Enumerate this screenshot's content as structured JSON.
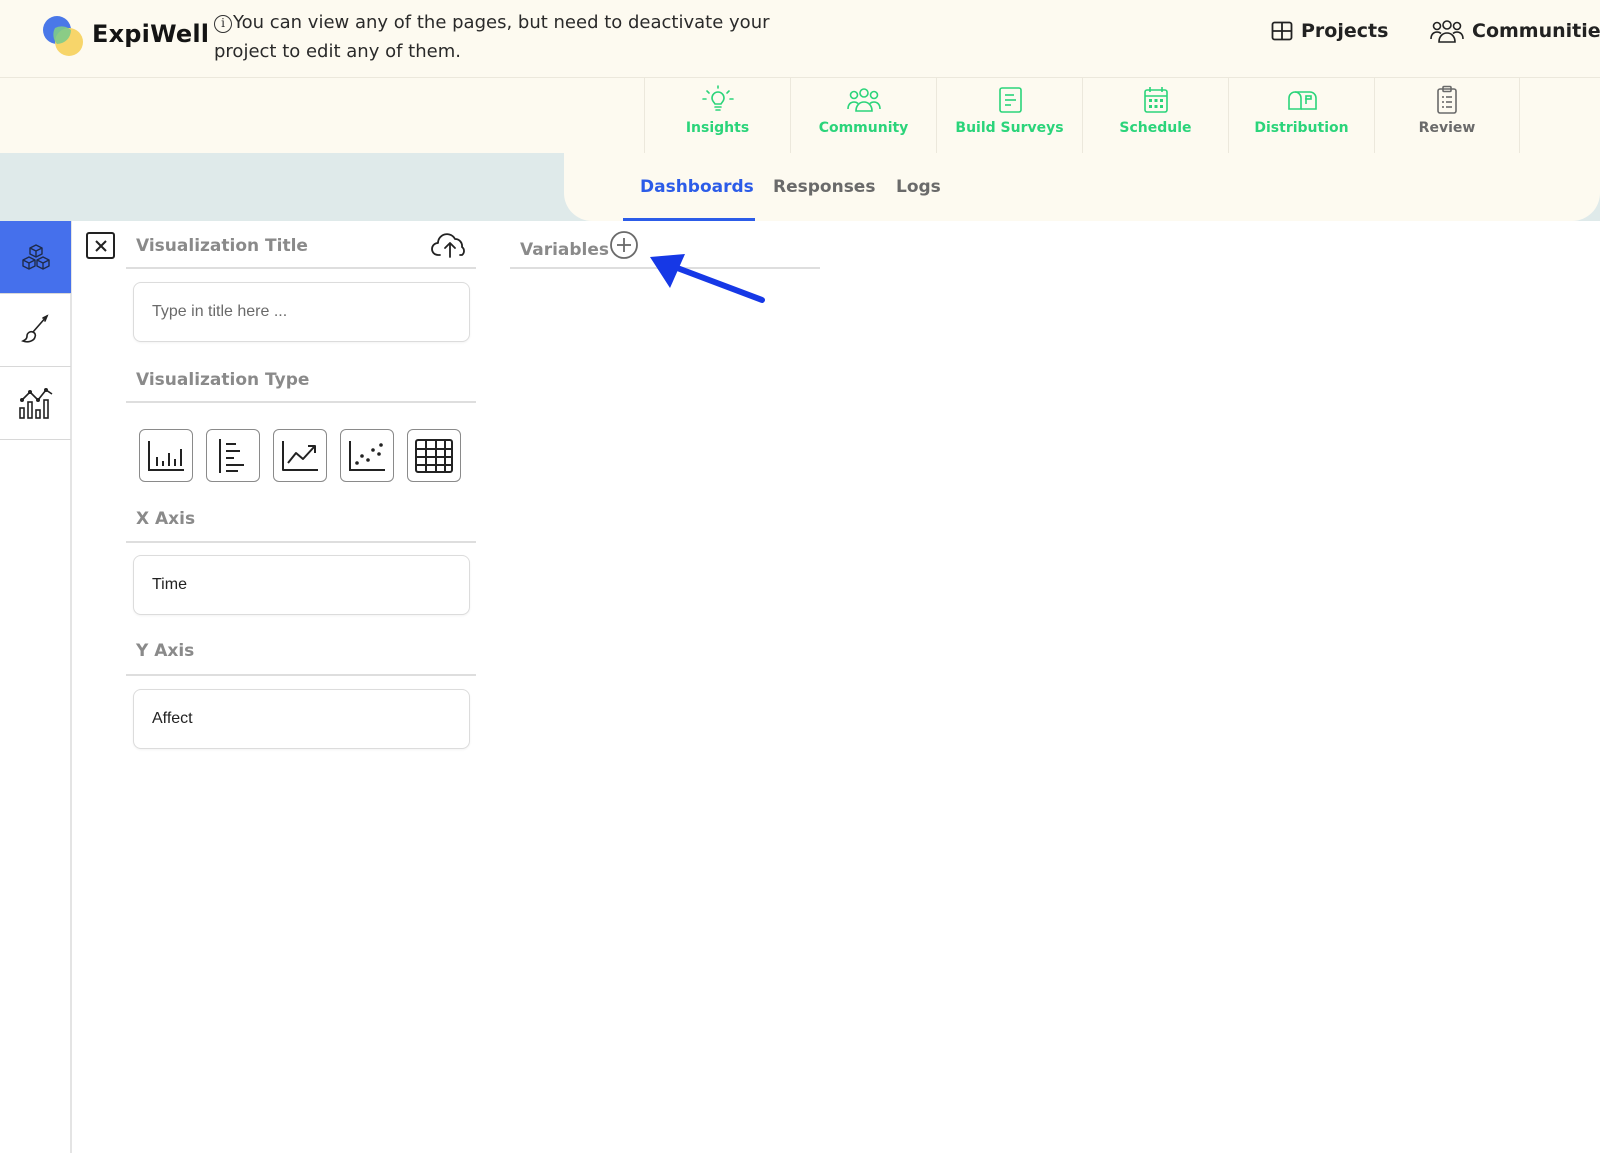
{
  "header": {
    "brand": "ExpiWell",
    "notice_icon": "i",
    "notice": "You can view any of the pages, but need to deactivate your project to edit any of them.",
    "links": [
      {
        "label": "Projects",
        "icon": "grid-icon"
      },
      {
        "label": "Communities",
        "icon": "people-icon"
      }
    ]
  },
  "modules": [
    {
      "label": "Insights",
      "icon": "lightbulb-icon"
    },
    {
      "label": "Community",
      "icon": "people-icon"
    },
    {
      "label": "Build Surveys",
      "icon": "survey-icon"
    },
    {
      "label": "Schedule",
      "icon": "calendar-icon"
    },
    {
      "label": "Distribution",
      "icon": "mailbox-icon"
    },
    {
      "label": "Review",
      "icon": "clipboard-icon"
    }
  ],
  "tabs": [
    {
      "label": "Dashboards",
      "active": true
    },
    {
      "label": "Responses",
      "active": false
    },
    {
      "label": "Logs",
      "active": false
    }
  ],
  "rail": [
    "cubes-icon",
    "brush-icon",
    "chart-icon"
  ],
  "editor": {
    "title_label": "Visualization Title",
    "title_placeholder": "Type in title here ...",
    "type_label": "Visualization Type",
    "types": [
      "bar-chart-icon",
      "horizontal-bar-icon",
      "line-chart-icon",
      "scatter-icon",
      "table-icon"
    ],
    "x_label": "X Axis",
    "x_value": "Time",
    "y_label": "Y Axis",
    "y_value": "Affect"
  },
  "variables": {
    "label": "Variables"
  },
  "colors": {
    "accent": "#2c5ce8",
    "green": "#2bd47a",
    "rail_active": "#4570ec",
    "header_bg": "#fdfaf0",
    "band_bg": "#dfeaea",
    "arrow": "#1638e6"
  }
}
